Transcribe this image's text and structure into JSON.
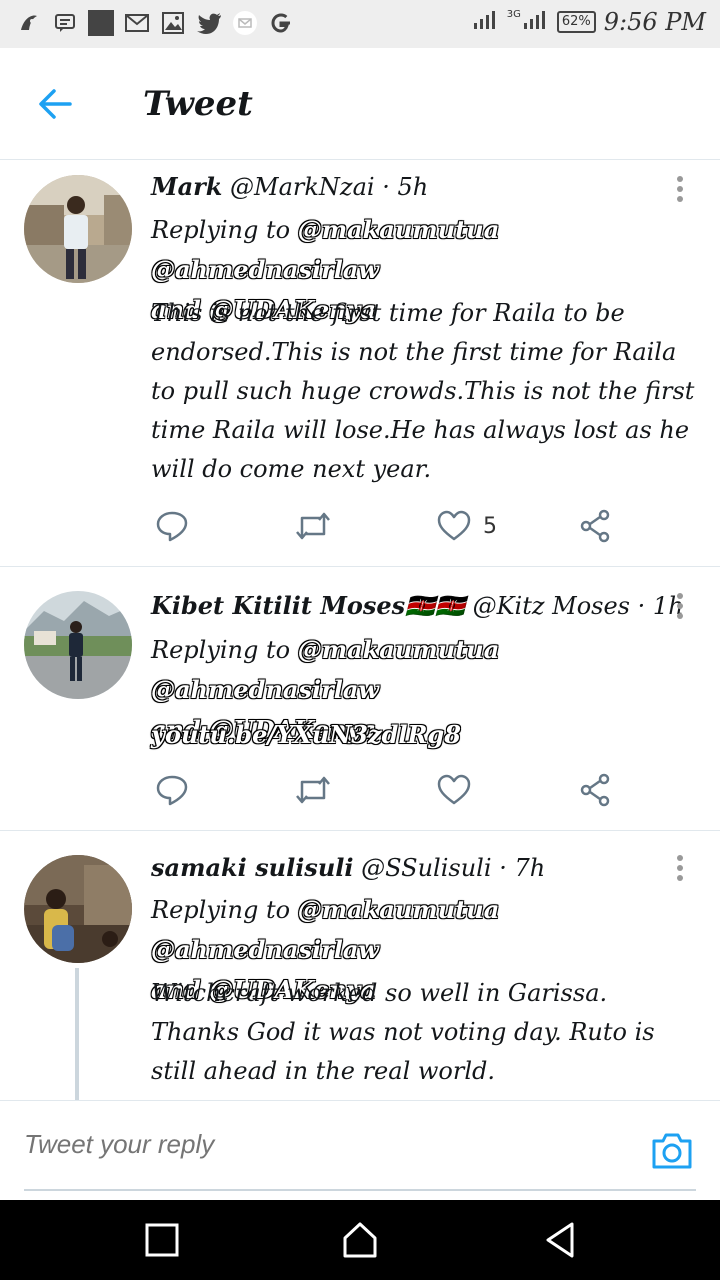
{
  "status_bar": {
    "network": "3G",
    "battery": "62%",
    "time": "9:56 PM"
  },
  "header": {
    "title": "Tweet"
  },
  "tweets": [
    {
      "name": "Mark",
      "handle": "@MarkNzai",
      "time": "5h",
      "replying_prefix": "Replying to",
      "mentions_line1": "@makaumutua @ahmednasirlaw",
      "mentions_line2": "and @UDAKenya",
      "text": "This is not the first time for Raila to be endorsed.This is not the first time for Raila to pull such huge crowds.This is not the first time Raila will lose.He has always lost as he will do come next year.",
      "likes": "5"
    },
    {
      "name": "Kibet Kitilit Moses🇰🇪🇰🇪",
      "handle": "@Kitz Moses",
      "time": "1h",
      "replying_prefix": "Replying to",
      "mentions_line1": "@makaumutua @ahmednasirlaw",
      "mentions_line2": "and @UDAKenya",
      "link": "youtu.be/YXuN3zdlRg8",
      "likes": ""
    },
    {
      "name": "samaki sulisuli",
      "handle": "@SSulisuli",
      "time": "7h",
      "replying_prefix": "Replying to",
      "mentions_line1": "@makaumutua @ahmednasirlaw",
      "mentions_line2": "and @UDAKenya",
      "text": "Witchcraft worked so well in Garissa. Thanks God it was not voting day. Ruto is still ahead in the real world."
    }
  ],
  "reply_bar": {
    "placeholder": "Tweet your reply"
  },
  "colors": {
    "accent": "#1da1f2",
    "icon_gray": "#657786",
    "divider": "#e1e8ed"
  }
}
